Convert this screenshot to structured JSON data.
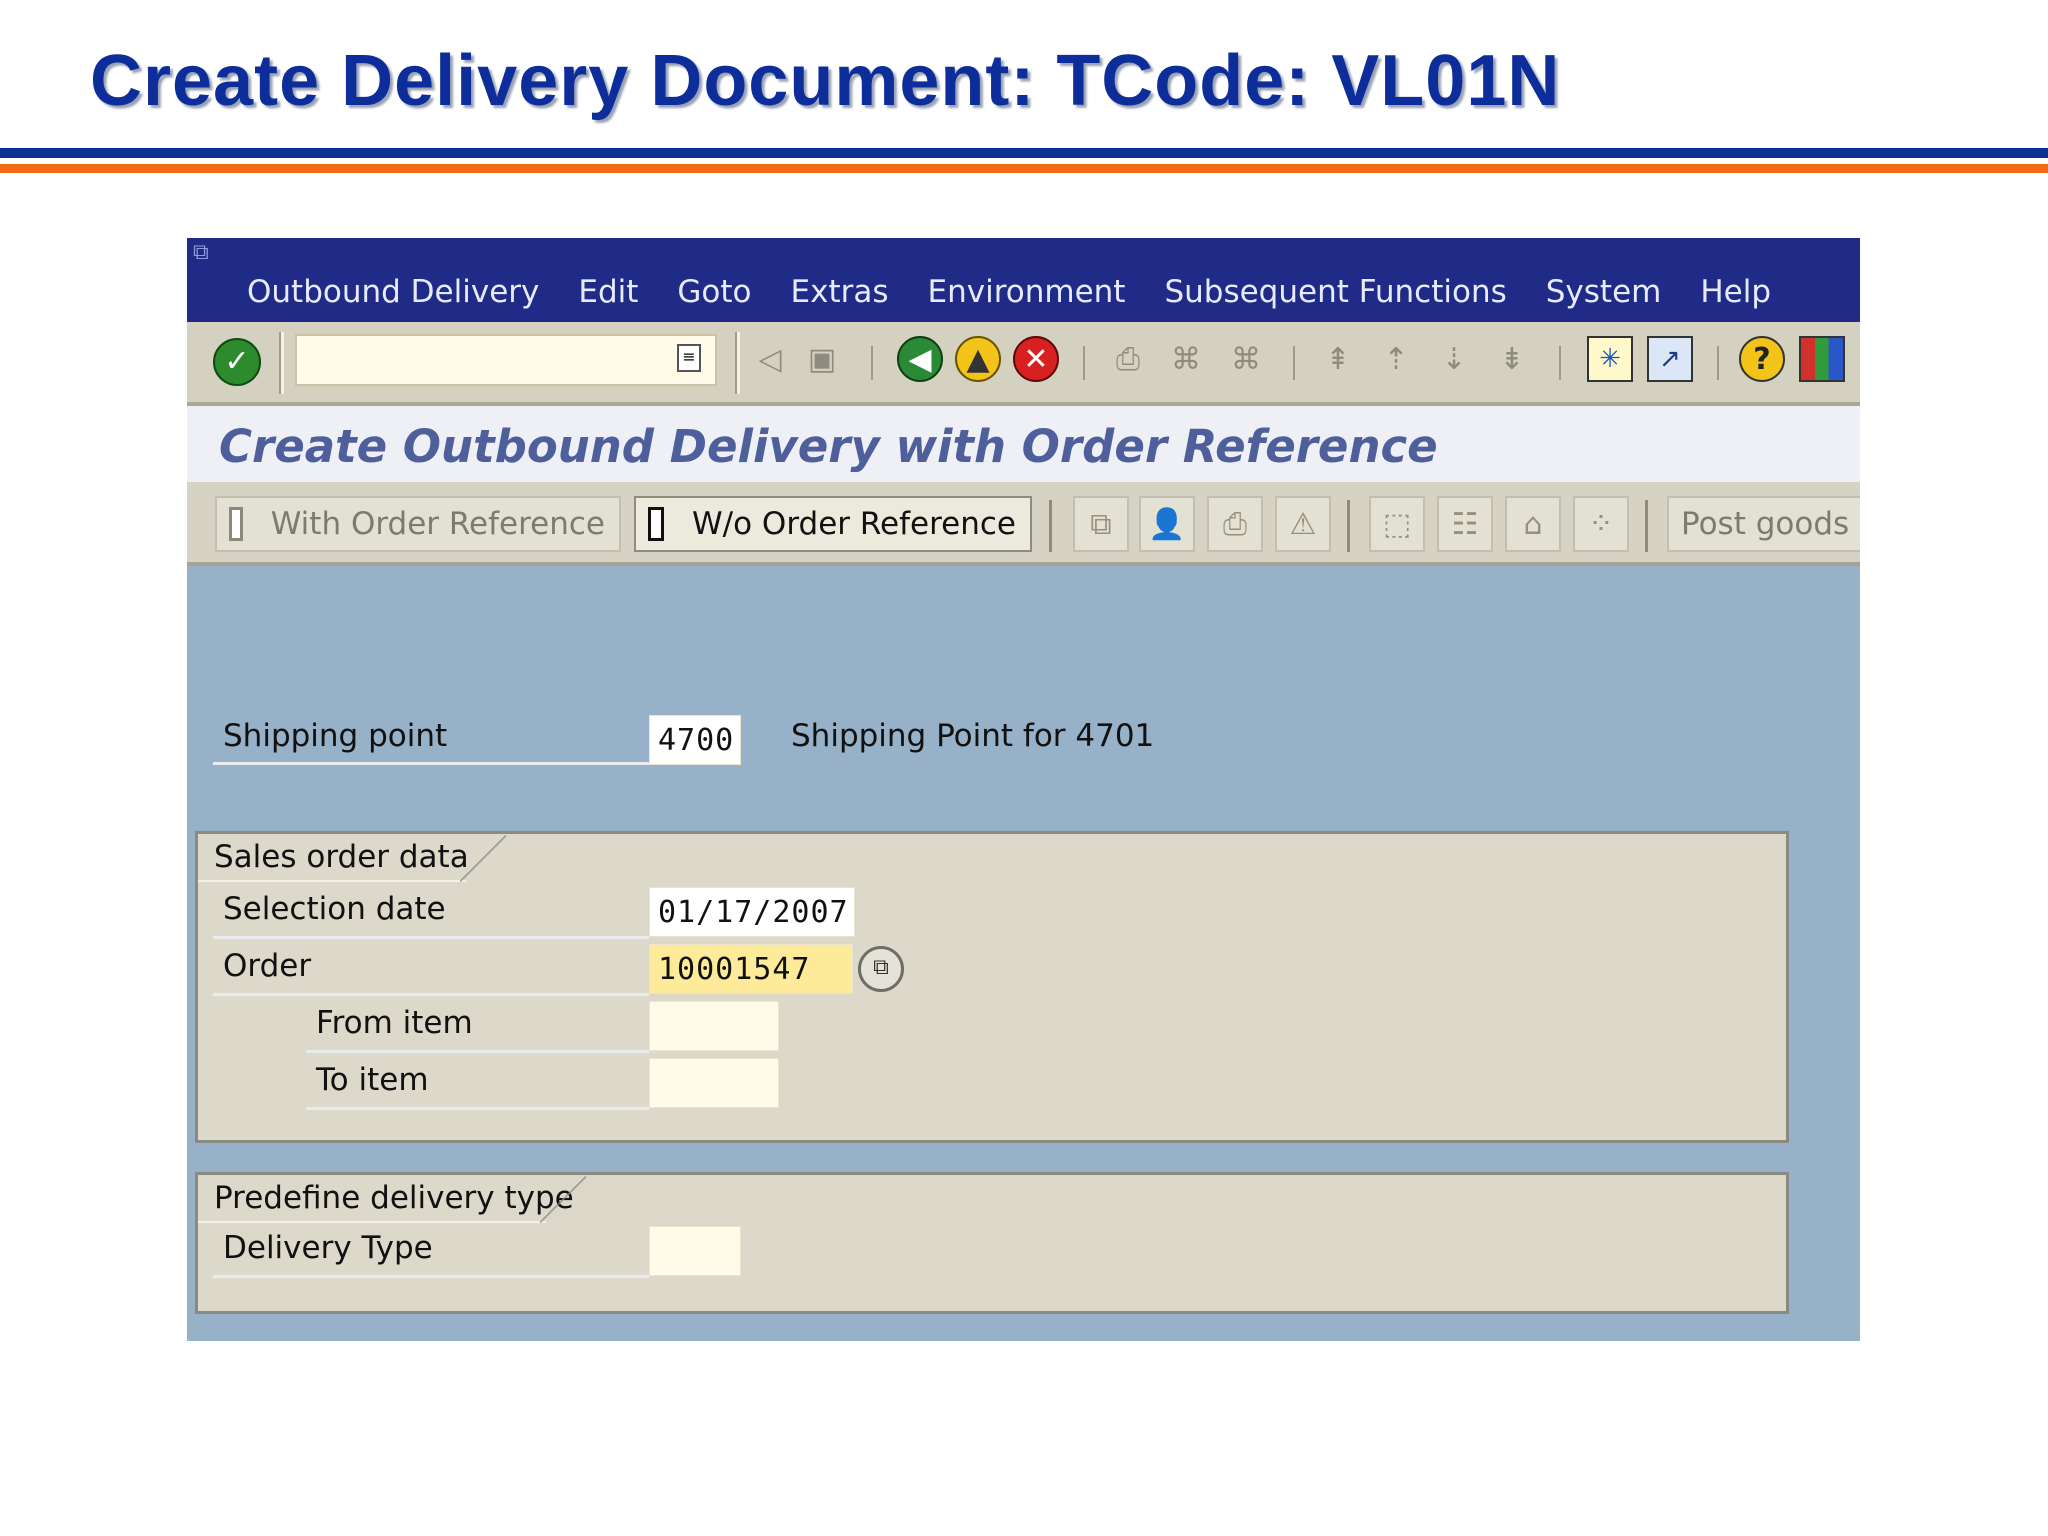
{
  "slide": {
    "title": "Create Delivery Document: TCode: VL01N"
  },
  "menubar": {
    "items": [
      "Outbound Delivery",
      "Edit",
      "Goto",
      "Extras",
      "Environment",
      "Subsequent Functions",
      "System",
      "Help"
    ]
  },
  "toolbar": {
    "command_field_value": "",
    "icons": [
      "enter-icon",
      "command-field",
      "back-arrow-icon",
      "save-icon",
      "back-icon",
      "exit-icon",
      "cancel-icon",
      "print-icon",
      "find-icon",
      "find-next-icon",
      "first-page-icon",
      "previous-page-icon",
      "next-page-icon",
      "last-page-icon",
      "create-session-icon",
      "create-shortcut-icon",
      "help-icon",
      "layout-menu-icon"
    ]
  },
  "screen": {
    "title": "Create Outbound Delivery with Order Reference"
  },
  "app_toolbar": {
    "with_order_reference": "With Order Reference",
    "wo_order_reference": "W/o Order Reference",
    "post_goods": "Post goods"
  },
  "form": {
    "shipping_point_label": "Shipping point",
    "shipping_point_value": "4700",
    "shipping_point_description": "Shipping Point for 4701",
    "sales_order_group_title": "Sales order data",
    "selection_date_label": "Selection date",
    "selection_date_value": "01/17/2007",
    "order_label": "Order",
    "order_value": "10001547",
    "from_item_label": "From item",
    "from_item_value": "",
    "to_item_label": "To item",
    "to_item_value": "",
    "delivery_type_group_title": "Predefine delivery type",
    "delivery_type_label": "Delivery Type",
    "delivery_type_value": ""
  },
  "colors": {
    "slide_title": "#0d2e9a",
    "rule_blue": "#0b3192",
    "rule_orange": "#f26a14",
    "menubar": "#1f2b86",
    "screen_background": "#96b1c8",
    "group_background": "#dcd9cb",
    "active_input": "#fdeb9a"
  }
}
